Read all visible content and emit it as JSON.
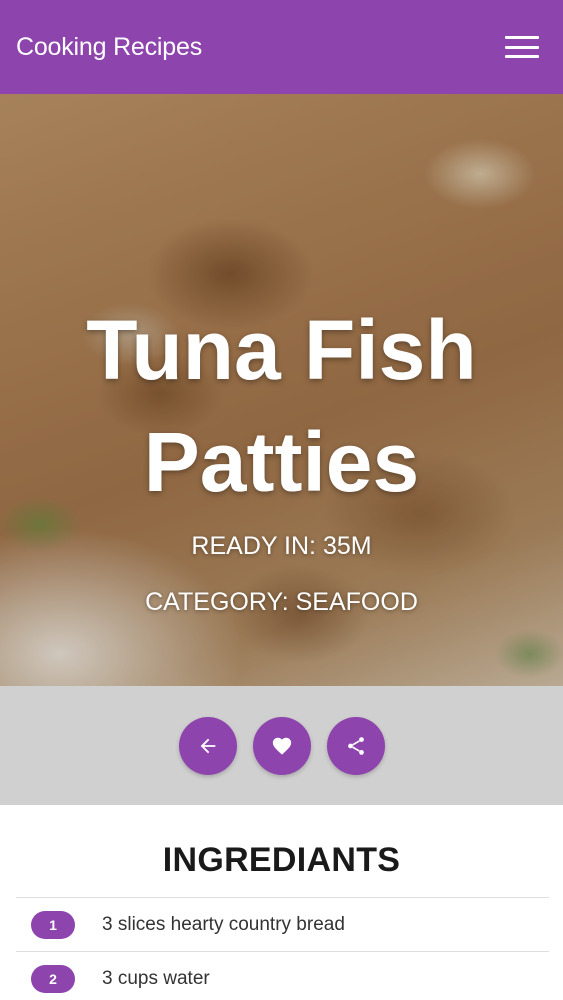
{
  "appbar": {
    "title": "Cooking Recipes",
    "menu_icon": "hamburger-menu-icon"
  },
  "recipe": {
    "title_line1": "Tuna Fish",
    "title_line2": "Patties",
    "ready_in": "READY IN: 35M",
    "category": "CATEGORY: SEAFOOD"
  },
  "actions": {
    "back_icon": "arrow-left-icon",
    "favorite_icon": "heart-icon",
    "share_icon": "share-icon"
  },
  "ingredients": {
    "heading": "INGREDIANTS",
    "items": [
      {
        "number": "1",
        "text": "3 slices hearty country bread"
      },
      {
        "number": "2",
        "text": "3 cups water"
      }
    ]
  },
  "colors": {
    "accent": "#8e44ad",
    "actions_bar": "#d0d0d0"
  }
}
